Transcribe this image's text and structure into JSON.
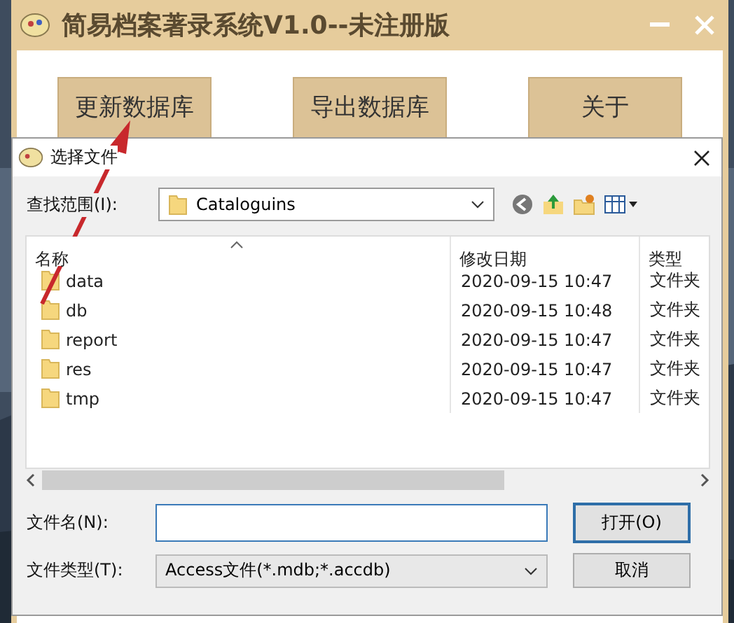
{
  "app_window": {
    "title": "简易档案著录系统V1.0--未注册版",
    "buttons": [
      "更新数据库",
      "导出数据库",
      "关于"
    ]
  },
  "dialog": {
    "title": "选择文件",
    "look_in_label": "查找范围(I):",
    "look_in_value": "Cataloguins",
    "columns": [
      "名称",
      "修改日期",
      "类型"
    ],
    "rows": [
      {
        "name": "data",
        "date": "2020-09-15 10:47",
        "type": "文件夹"
      },
      {
        "name": "db",
        "date": "2020-09-15 10:48",
        "type": "文件夹"
      },
      {
        "name": "report",
        "date": "2020-09-15 10:47",
        "type": "文件夹"
      },
      {
        "name": "res",
        "date": "2020-09-15 10:47",
        "type": "文件夹"
      },
      {
        "name": "tmp",
        "date": "2020-09-15 10:47",
        "type": "文件夹"
      }
    ],
    "file_name_label": "文件名(N):",
    "file_type_label": "文件类型(T):",
    "file_type_value": "Access文件(*.mdb;*.accdb)",
    "open_button": "打开(O)",
    "cancel_button": "取消"
  }
}
